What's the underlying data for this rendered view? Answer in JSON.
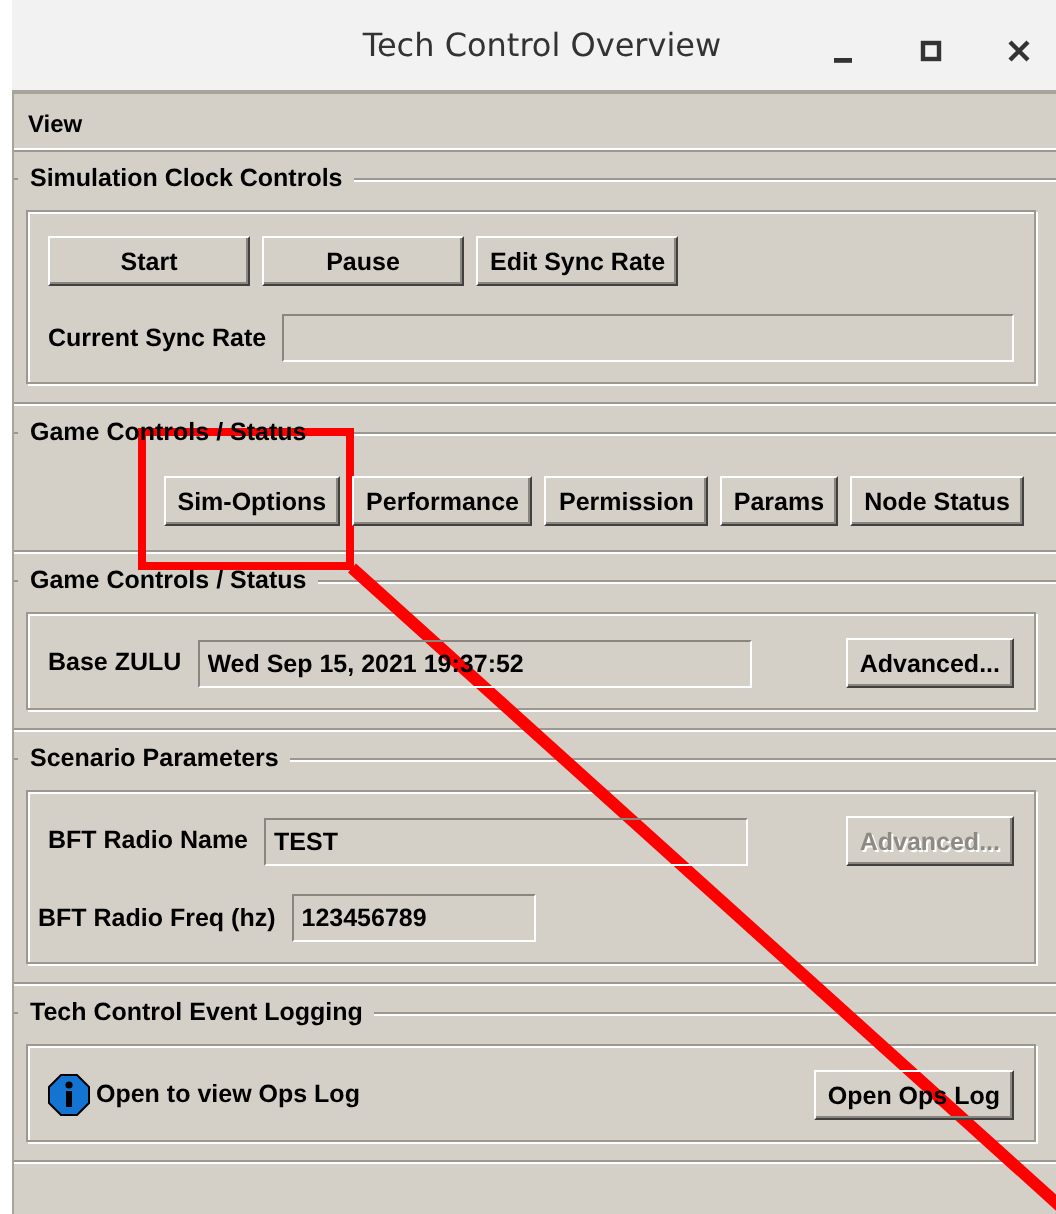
{
  "window": {
    "title": "Tech Control Overview"
  },
  "menu": [
    {
      "label": "View"
    }
  ],
  "sections": [
    {
      "title": "Simulation Clock Controls",
      "framed": true,
      "rows": [
        [
          {
            "kind": "button",
            "label": "Start",
            "disabled": false
          },
          {
            "kind": "button",
            "label": "Pause",
            "disabled": false
          },
          {
            "kind": "button",
            "label": "Edit Sync Rate",
            "disabled": false
          }
        ],
        [
          {
            "kind": "label",
            "text": "Current Sync Rate"
          },
          {
            "kind": "field"
          }
        ]
      ]
    },
    {
      "title": "Game Controls / Status",
      "framed": false,
      "rows": [
        [
          {
            "kind": "button",
            "label": "Sim-Options",
            "disabled": false
          },
          {
            "kind": "button",
            "label": "Performance",
            "disabled": false
          },
          {
            "kind": "button",
            "label": "Permission",
            "disabled": false
          },
          {
            "kind": "button",
            "label": "Params",
            "disabled": false
          },
          {
            "kind": "button",
            "label": "Node Status",
            "disabled": false
          }
        ]
      ]
    },
    {
      "title": "Game Controls / Status",
      "framed": true,
      "rows": [
        [
          {
            "kind": "label",
            "text": "Base ZULU"
          },
          {
            "kind": "field",
            "value": "Wed Sep 15, 2021 19:37:52"
          },
          {
            "kind": "button",
            "label": "Advanced...",
            "disabled": false
          }
        ]
      ]
    },
    {
      "title": "Scenario Parameters",
      "framed": true,
      "rows": [
        [
          {
            "kind": "label",
            "text": "BFT Radio Name"
          },
          {
            "kind": "field",
            "value": "TEST"
          },
          {
            "kind": "button",
            "label": "Advanced...",
            "disabled": true
          }
        ],
        [
          {
            "kind": "label",
            "text": "BFT Radio Freq (hz)"
          },
          {
            "kind": "field",
            "value": "123456789"
          }
        ]
      ]
    },
    {
      "title": "Tech Control Event Logging",
      "framed": true,
      "rows": [
        [
          {
            "kind": "info",
            "text": "Open to view Ops Log"
          },
          {
            "kind": "button",
            "label": "Open Ops Log",
            "disabled": false
          }
        ]
      ]
    }
  ],
  "annotation": {
    "kind": "box-with-line"
  }
}
